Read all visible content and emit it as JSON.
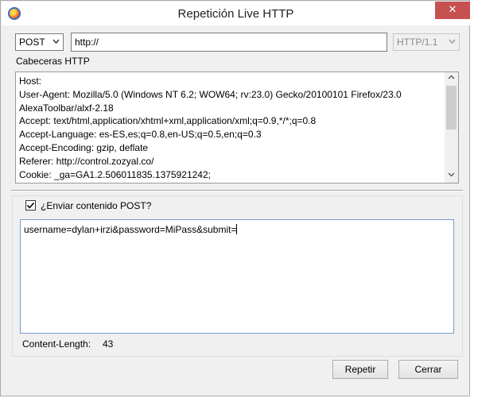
{
  "window": {
    "title": "Repetición Live HTTP",
    "close_label": "✕"
  },
  "request": {
    "method": "POST",
    "url": "http://",
    "http_version": "HTTP/1.1"
  },
  "headers_section": {
    "label": "Cabeceras HTTP",
    "lines": [
      "Host:",
      "User-Agent: Mozilla/5.0 (Windows NT 6.2; WOW64; rv:23.0) Gecko/20100101 Firefox/23.0",
      "AlexaToolbar/alxf-2.18",
      "Accept: text/html,application/xhtml+xml,application/xml;q=0.9,*/*;q=0.8",
      "Accept-Language: es-ES,es;q=0.8,en-US;q=0.5,en;q=0.3",
      "Accept-Encoding: gzip, deflate",
      "Referer: http://control.zozyal.co/",
      "Cookie: _ga=GA1.2.506011835.1375921242;"
    ]
  },
  "post_section": {
    "checkbox_label": "¿Enviar contenido POST?",
    "checked": true,
    "body": "username=dylan+irzi&password=MiPass&submit=",
    "content_length_label": "Content-Length:",
    "content_length_value": "43"
  },
  "buttons": {
    "repeat": "Repetir",
    "close": "Cerrar"
  },
  "colors": {
    "close_button": "#c75050",
    "dialog_bg": "#f0f0f0",
    "focus_border": "#7a9ccd"
  },
  "icons": {
    "app": "firefox-icon",
    "dropdown": "chevron-down-icon",
    "scroll_up": "arrow-up-icon",
    "scroll_down": "arrow-down-icon",
    "check": "checkmark-icon"
  }
}
